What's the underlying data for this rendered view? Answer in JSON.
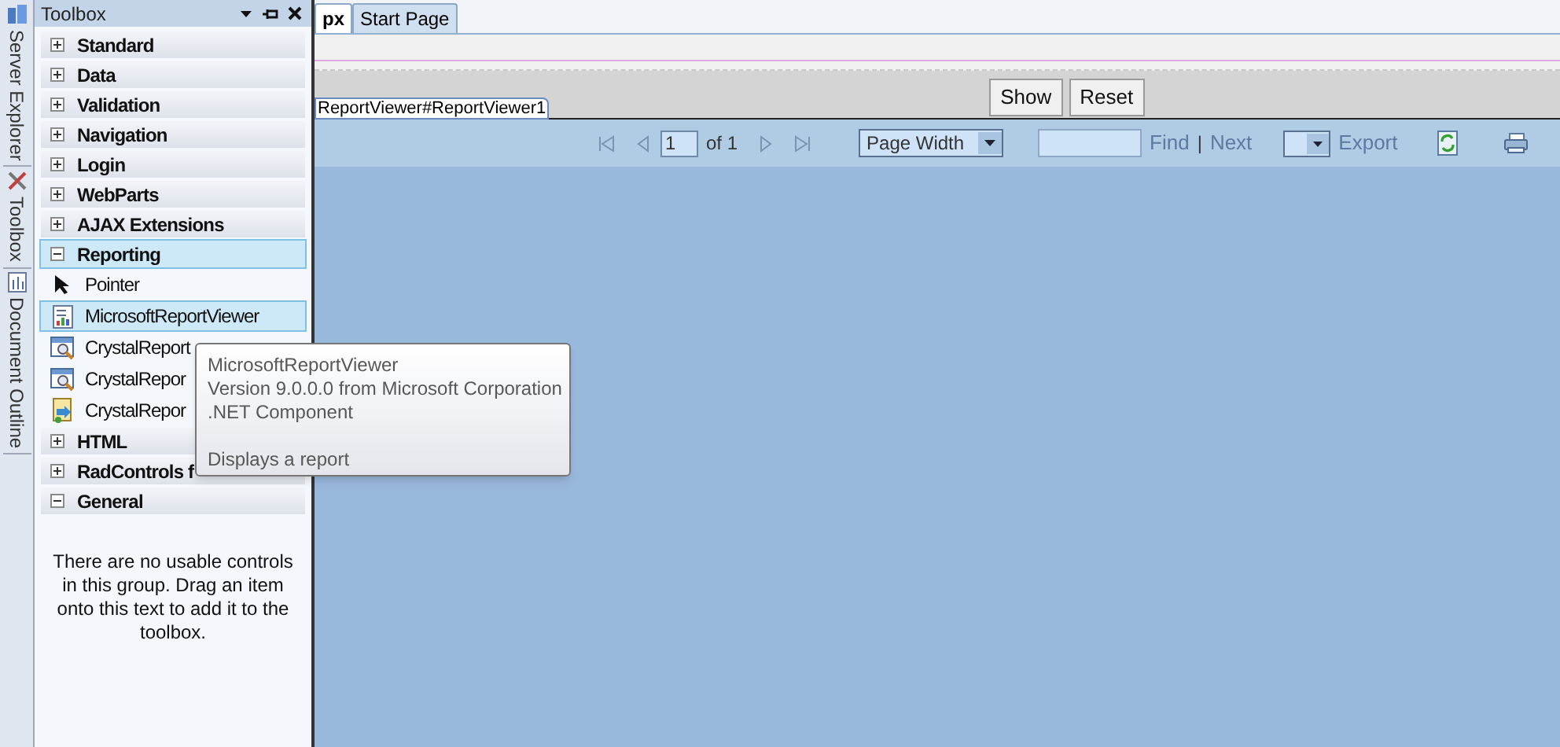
{
  "side_tabs": [
    {
      "label": "Server Explorer",
      "kind": "server"
    },
    {
      "label": "Toolbox",
      "kind": "tools"
    },
    {
      "label": "Document Outline",
      "kind": "outline"
    }
  ],
  "toolbox": {
    "title": "Toolbox",
    "groups": [
      {
        "label": "Standard",
        "expanded": false,
        "selected": false
      },
      {
        "label": "Data",
        "expanded": false,
        "selected": false
      },
      {
        "label": "Validation",
        "expanded": false,
        "selected": false
      },
      {
        "label": "Navigation",
        "expanded": false,
        "selected": false
      },
      {
        "label": "Login",
        "expanded": false,
        "selected": false
      },
      {
        "label": "WebParts",
        "expanded": false,
        "selected": false
      },
      {
        "label": "AJAX Extensions",
        "expanded": false,
        "selected": false
      },
      {
        "label": "Reporting",
        "expanded": true,
        "selected": true,
        "items": [
          {
            "label": "Pointer",
            "kind": "pointer",
            "selected": false
          },
          {
            "label": "MicrosoftReportViewer",
            "kind": "report",
            "selected": true
          },
          {
            "label": "CrystalReport",
            "kind": "crystal",
            "selected": false
          },
          {
            "label": "CrystalRepor",
            "kind": "crystal",
            "selected": false
          },
          {
            "label": "CrystalRepor",
            "kind": "crystal-doc",
            "selected": false
          }
        ]
      },
      {
        "label": "HTML",
        "expanded": false,
        "selected": false
      },
      {
        "label": "RadControls f",
        "expanded": false,
        "selected": false
      },
      {
        "label": "General",
        "expanded": true,
        "selected": false,
        "empty_message": "There are no usable controls in this group. Drag an item onto this text to add it to the toolbox."
      }
    ]
  },
  "tooltip": {
    "lines": [
      "MicrosoftReportViewer",
      "Version 9.0.0.0 from Microsoft Corporation",
      ".NET Component"
    ],
    "description": "Displays a report"
  },
  "doc_tabs": [
    {
      "label": "px",
      "selected": true
    },
    {
      "label": "Start Page",
      "selected": false
    }
  ],
  "buttons": [
    "Show",
    "Reset"
  ],
  "control_tag": "ReportViewer#ReportViewer1",
  "report_toolbar": {
    "page": "1",
    "of": "of 1",
    "zoom": "Page Width",
    "find": "Find",
    "separator": "|",
    "next": "Next",
    "export": "Export"
  }
}
